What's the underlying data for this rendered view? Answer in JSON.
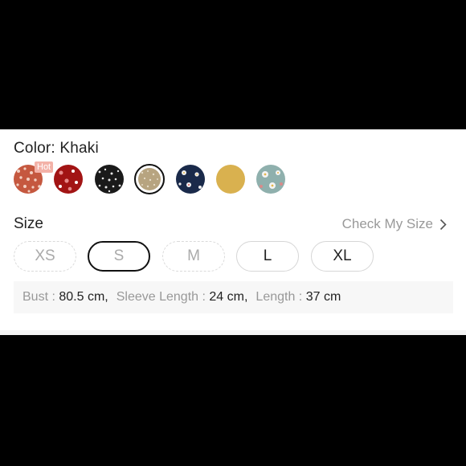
{
  "color": {
    "label": "Color: Khaki",
    "hot_badge": "Hot",
    "swatches": [
      {
        "name": "red-floral",
        "bg": "#c5583f",
        "dot": "#f2d0c2",
        "selected": false
      },
      {
        "name": "burgundy-floral",
        "bg": "#a21414",
        "dot": "#e68a8a",
        "selected": false
      },
      {
        "name": "black-ditsy",
        "bg": "#1a1a1a",
        "dot": "#e6e6e6",
        "selected": false
      },
      {
        "name": "khaki",
        "bg": "#b7a480",
        "dot": "#e6dcc7",
        "selected": true
      },
      {
        "name": "navy-floral",
        "bg": "#1a2a4a",
        "dot": "#f0f0f0",
        "selected": false
      },
      {
        "name": "mustard",
        "bg": "#d9b14f",
        "dot": "#d9b14f",
        "selected": false
      },
      {
        "name": "sage-floral",
        "bg": "#8fb0ad",
        "dot": "#f4f4f4",
        "selected": false
      }
    ]
  },
  "size": {
    "label": "Size",
    "check_label": "Check My Size",
    "options": [
      {
        "label": "XS",
        "state": "disabled"
      },
      {
        "label": "S",
        "state": "selected"
      },
      {
        "label": "M",
        "state": "disabled"
      },
      {
        "label": "L",
        "state": "normal"
      },
      {
        "label": "XL",
        "state": "normal"
      }
    ]
  },
  "measurements": [
    {
      "key": "Bust",
      "value": "80.5 cm"
    },
    {
      "key": "Sleeve Length",
      "value": "24 cm"
    },
    {
      "key": "Length",
      "value": "37 cm"
    }
  ],
  "colors": {
    "selected_border": "#111111",
    "muted_text": "#999999"
  }
}
